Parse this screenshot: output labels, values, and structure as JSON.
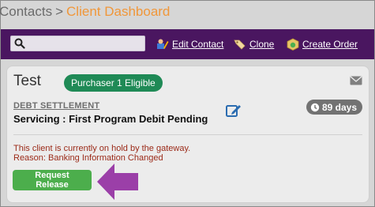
{
  "breadcrumb": {
    "root": "Contacts",
    "separator": ">",
    "current": "Client Dashboard"
  },
  "toolbar": {
    "search_value": "",
    "edit_contact_label": "Edit Contact",
    "clone_label": "Clone",
    "create_order_label": "Create Order"
  },
  "client": {
    "name": "Test",
    "eligibility_badge": "Purchaser 1 Eligible",
    "program_type": "DEBT SETTLEMENT",
    "status_label": "Servicing",
    "status_separator": " : ",
    "status_value": "First Program Debit Pending",
    "days_badge": "89 days",
    "hold_message": "This client is currently on hold by the gateway.",
    "hold_reason": "Reason: Banking Information Changed",
    "release_button_label": "Request Release"
  },
  "colors": {
    "toolbar_bg": "#4a1660",
    "breadcrumb_accent": "#f0973a",
    "eligible_badge": "#1f8a56",
    "release_button": "#4cae4c",
    "hold_text": "#9b2a18",
    "arrow_annotation": "#9b3fa8"
  }
}
